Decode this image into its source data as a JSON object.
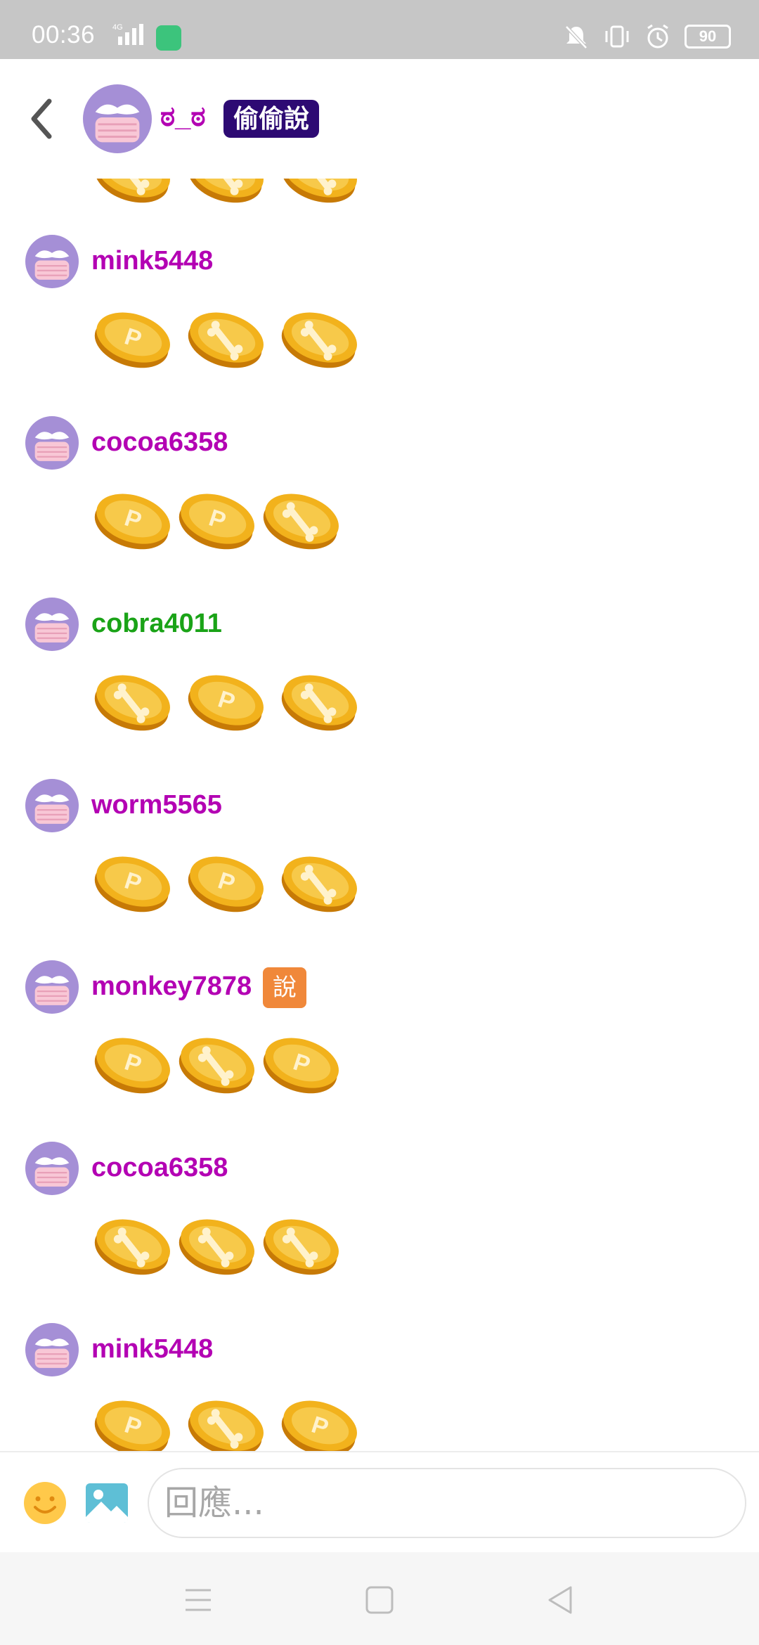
{
  "status_bar": {
    "time": "00:36",
    "network": "4G",
    "battery": "90",
    "icons": [
      "signal-icon",
      "app-notification-icon",
      "mute-icon",
      "vibrate-icon",
      "alarm-icon",
      "battery-icon"
    ]
  },
  "header": {
    "name": "ಠ_ಠ",
    "badge": "偷偷說"
  },
  "messages": [
    {
      "user": "mink5448",
      "color": "#b300b3",
      "tag": "",
      "coins": [
        "p",
        "bone",
        "bone"
      ]
    },
    {
      "user": "cocoa6358",
      "color": "#b300b3",
      "tag": "",
      "coins": [
        "p",
        "p",
        "bone"
      ]
    },
    {
      "user": "cobra4011",
      "color": "#1aa317",
      "tag": "",
      "coins": [
        "bone",
        "p",
        "bone"
      ]
    },
    {
      "user": "worm5565",
      "color": "#b300b3",
      "tag": "",
      "coins": [
        "p",
        "p",
        "bone"
      ]
    },
    {
      "user": "monkey7878",
      "color": "#b300b3",
      "tag": "說",
      "coins": [
        "p",
        "bone",
        "p"
      ]
    },
    {
      "user": "cocoa6358",
      "color": "#b300b3",
      "tag": "",
      "coins": [
        "bone",
        "bone",
        "bone"
      ]
    },
    {
      "user": "mink5448",
      "color": "#b300b3",
      "tag": "",
      "coins": [
        "p",
        "bone",
        "p"
      ]
    }
  ],
  "input": {
    "placeholder": "回應..."
  },
  "colors": {
    "username": "#b300b3",
    "username_alt": "#1aa317",
    "badge_bg": "#2d0a73",
    "tag_bg": "#f0883a",
    "coin_face": "#f2b21c",
    "coin_edge": "#c77a06"
  }
}
